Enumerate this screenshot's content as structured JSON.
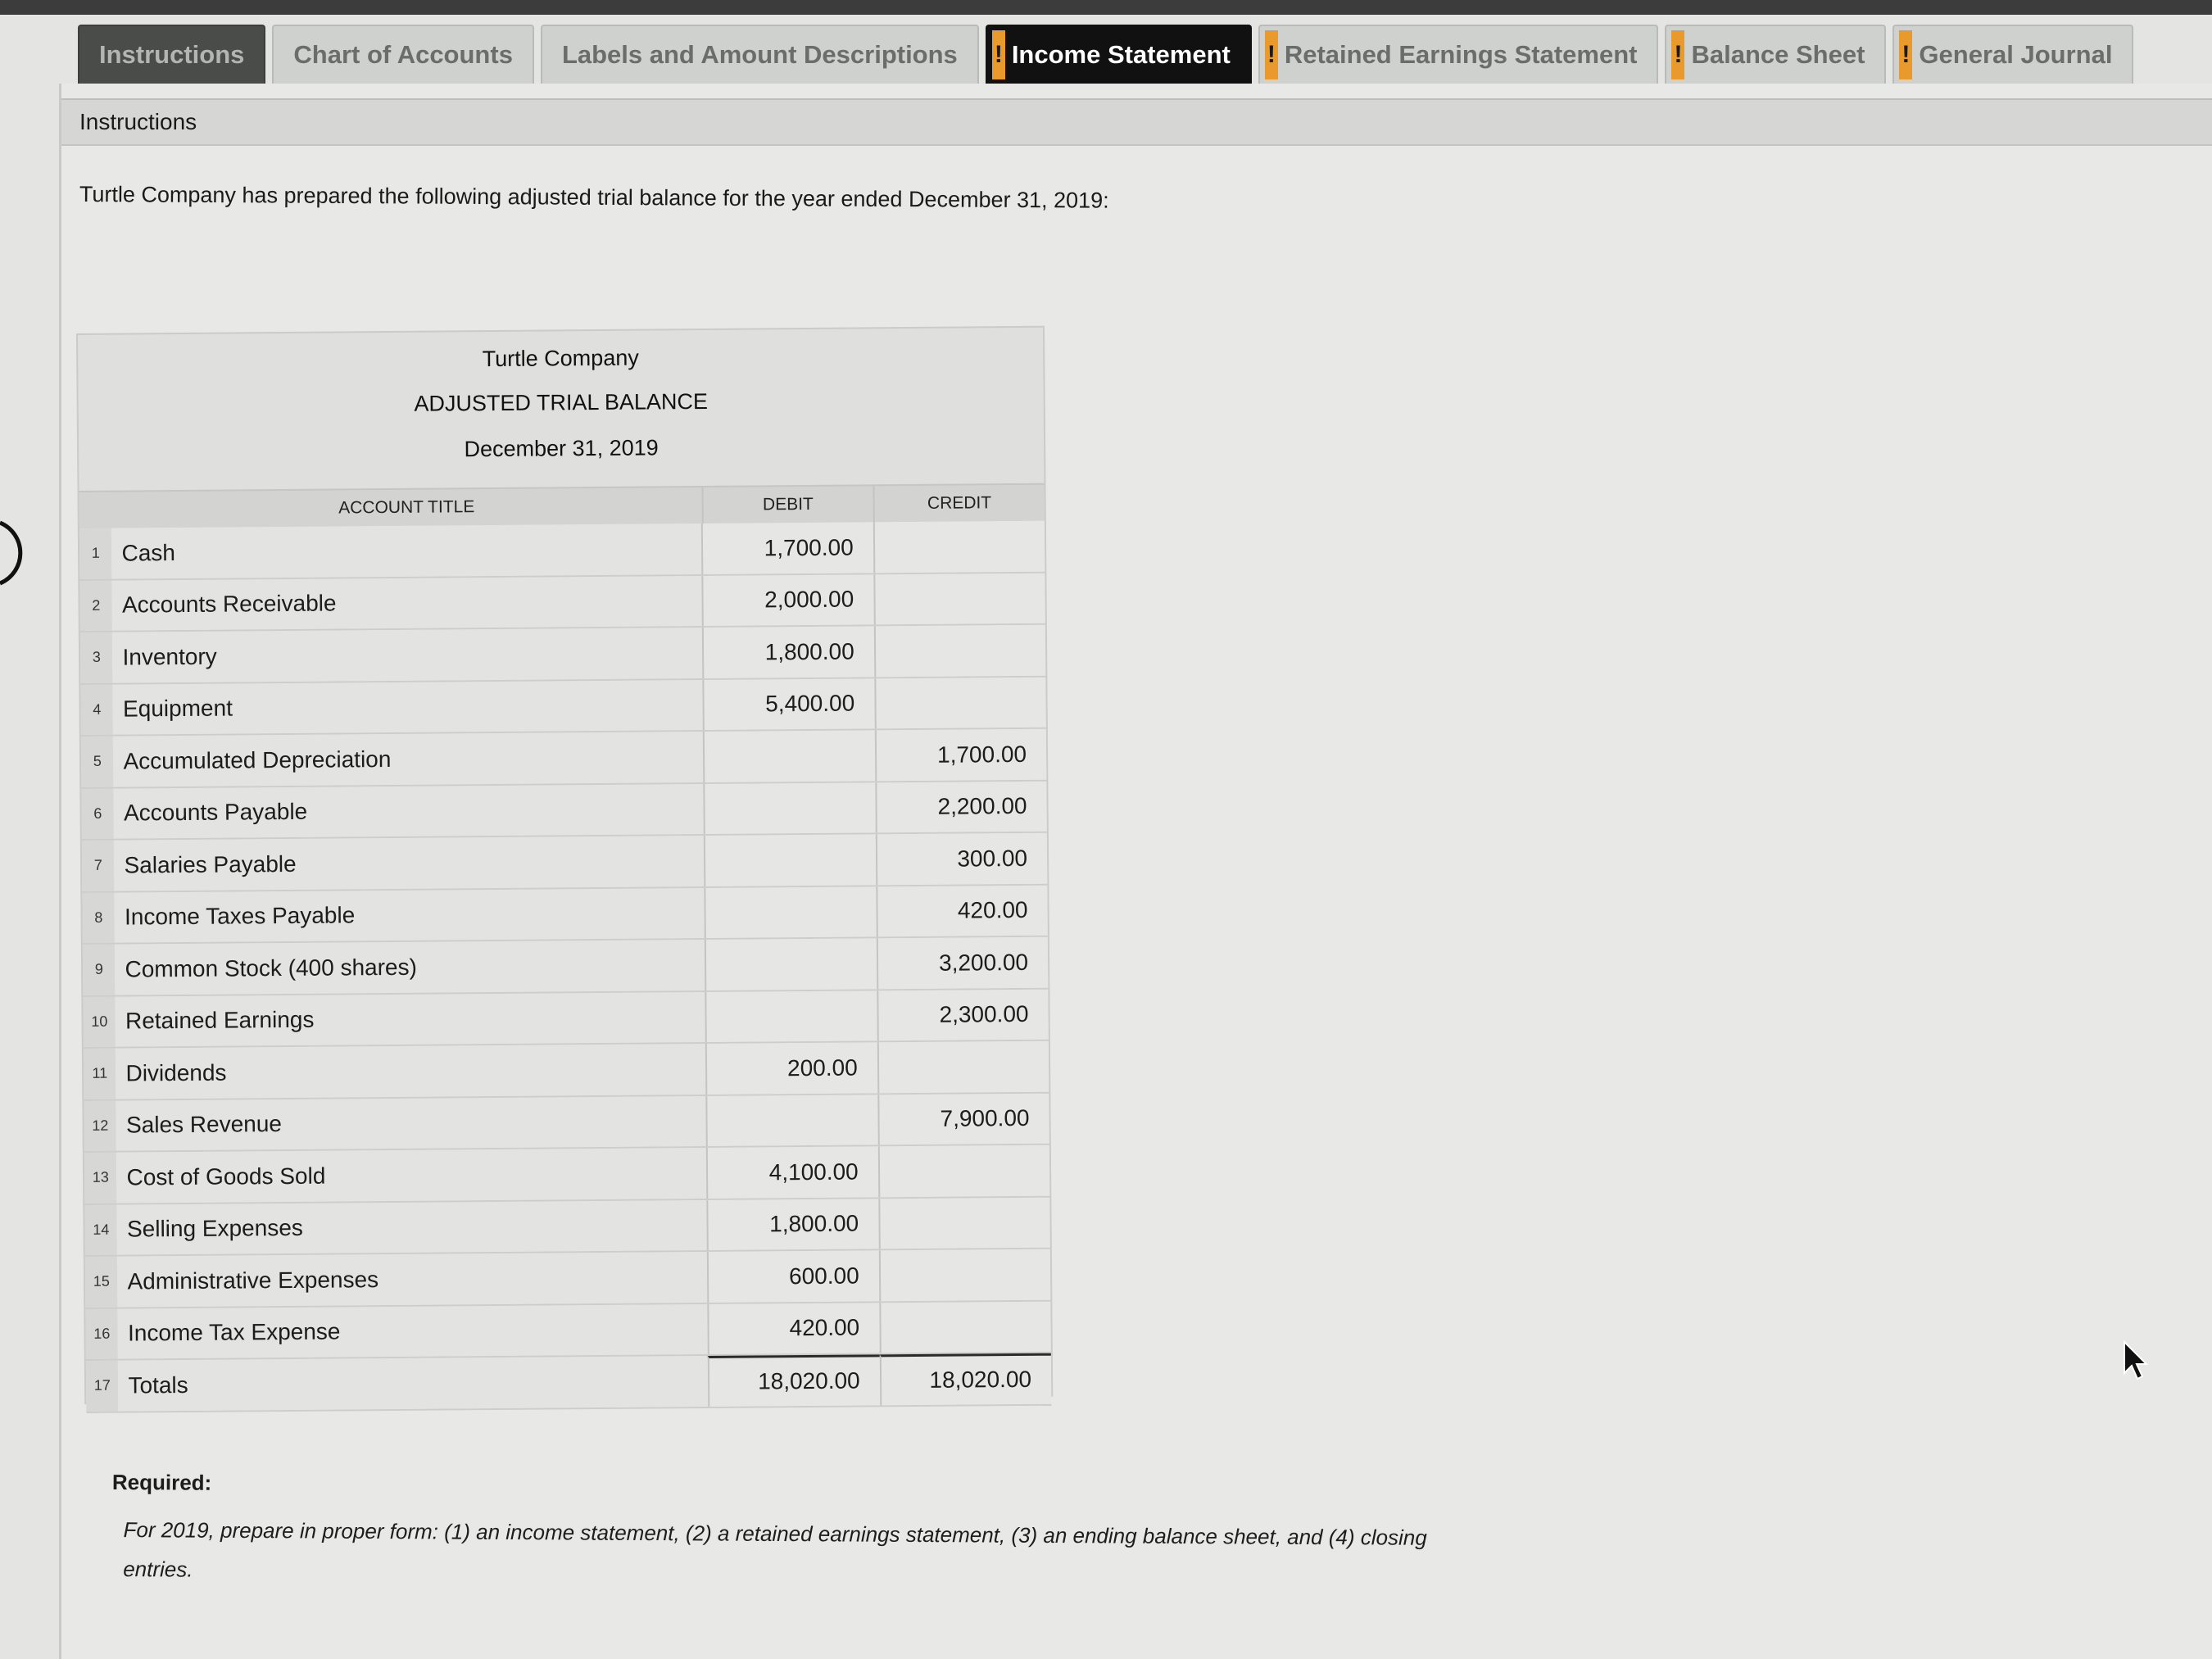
{
  "tabs": [
    {
      "label": "Instructions",
      "flag": false,
      "style": "active-dark"
    },
    {
      "label": "Chart of Accounts",
      "flag": false,
      "style": ""
    },
    {
      "label": "Labels and Amount Descriptions",
      "flag": false,
      "style": ""
    },
    {
      "label": "Income Statement",
      "flag": true,
      "style": "current"
    },
    {
      "label": "Retained Earnings Statement",
      "flag": true,
      "style": ""
    },
    {
      "label": "Balance Sheet",
      "flag": true,
      "style": ""
    },
    {
      "label": "General Journal",
      "flag": true,
      "style": ""
    }
  ],
  "flag_glyph": "!",
  "section": {
    "title": "Instructions"
  },
  "intro": "Turtle Company has prepared the following adjusted trial balance for the year ended December 31, 2019:",
  "trial_balance": {
    "company": "Turtle Company",
    "title": "ADJUSTED TRIAL BALANCE",
    "date": "December 31, 2019",
    "headers": {
      "account": "ACCOUNT TITLE",
      "debit": "DEBIT",
      "credit": "CREDIT"
    },
    "rows": [
      {
        "num": "1",
        "account": "Cash",
        "debit": "1,700.00",
        "credit": ""
      },
      {
        "num": "2",
        "account": "Accounts Receivable",
        "debit": "2,000.00",
        "credit": ""
      },
      {
        "num": "3",
        "account": "Inventory",
        "debit": "1,800.00",
        "credit": ""
      },
      {
        "num": "4",
        "account": "Equipment",
        "debit": "5,400.00",
        "credit": ""
      },
      {
        "num": "5",
        "account": "Accumulated Depreciation",
        "debit": "",
        "credit": "1,700.00"
      },
      {
        "num": "6",
        "account": "Accounts Payable",
        "debit": "",
        "credit": "2,200.00"
      },
      {
        "num": "7",
        "account": "Salaries Payable",
        "debit": "",
        "credit": "300.00"
      },
      {
        "num": "8",
        "account": "Income Taxes Payable",
        "debit": "",
        "credit": "420.00"
      },
      {
        "num": "9",
        "account": "Common Stock (400 shares)",
        "debit": "",
        "credit": "3,200.00"
      },
      {
        "num": "10",
        "account": "Retained Earnings",
        "debit": "",
        "credit": "2,300.00"
      },
      {
        "num": "11",
        "account": "Dividends",
        "debit": "200.00",
        "credit": ""
      },
      {
        "num": "12",
        "account": "Sales Revenue",
        "debit": "",
        "credit": "7,900.00"
      },
      {
        "num": "13",
        "account": "Cost of Goods Sold",
        "debit": "4,100.00",
        "credit": ""
      },
      {
        "num": "14",
        "account": "Selling Expenses",
        "debit": "1,800.00",
        "credit": ""
      },
      {
        "num": "15",
        "account": "Administrative Expenses",
        "debit": "600.00",
        "credit": ""
      },
      {
        "num": "16",
        "account": "Income Tax Expense",
        "debit": "420.00",
        "credit": ""
      },
      {
        "num": "17",
        "account": "Totals",
        "debit": "18,020.00",
        "credit": "18,020.00"
      }
    ]
  },
  "required": {
    "label": "Required:",
    "text": "For 2019, prepare in proper form: (1) an income statement, (2) a retained earnings statement, (3) an ending balance sheet, and (4) closing entries."
  },
  "colors": {
    "flag": "#e99a2c",
    "current_tab_bg": "#111111",
    "panel_bg": "#e8e9e7"
  }
}
